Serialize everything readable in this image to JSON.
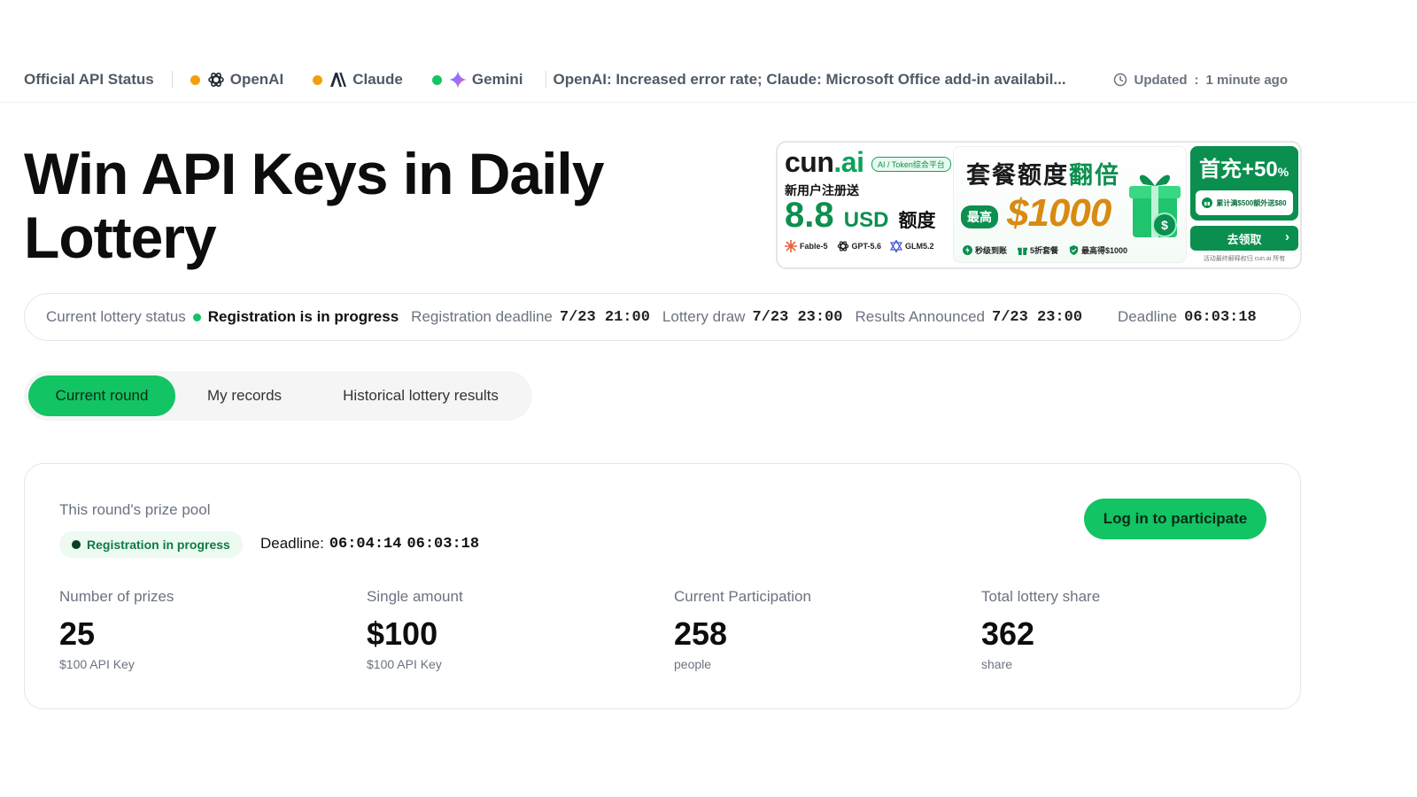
{
  "status_bar": {
    "title": "Official API Status",
    "providers": [
      {
        "name": "OpenAI",
        "status_color": "#f59e0b",
        "icon": "openai-icon"
      },
      {
        "name": "Claude",
        "status_color": "#f59e0b",
        "icon": "anthropic-icon"
      },
      {
        "name": "Gemini",
        "status_color": "#12c463",
        "icon": "gemini-icon"
      }
    ],
    "incident_text": "OpenAI: Increased error rate; Claude: Microsoft Office add-in availabil...",
    "updated_label": "Updated",
    "updated_sep": ":",
    "updated_value": "1 minute ago"
  },
  "hero": {
    "title": "Win API Keys in Daily Lottery"
  },
  "ad": {
    "brand_main": "cun",
    "brand_suffix": ".ai",
    "tag": "AI / Token综合平台",
    "register_text": "新用户注册送",
    "amount": "8.8",
    "amount_unit": "USD",
    "amount_cn": "额度",
    "models": [
      "Fable-5",
      "GPT-5.6",
      "GLM5.2"
    ],
    "headline_a": "套餐额度",
    "headline_b": "翻倍",
    "max_label": "最高",
    "max_amount": "$1000",
    "features": [
      "秒级到账",
      "5折套餐",
      "最高得$1000"
    ],
    "first_topup": "首充",
    "first_bonus": "+50",
    "first_pct": "%",
    "extra_text": "累计满$500额外送$80",
    "claim_label": "去领取",
    "footnote": "活动最终解释权归 cun.ai 所有"
  },
  "lottery_status": {
    "status_label": "Current lottery status",
    "status_value": "Registration is in progress",
    "reg_deadline_label": "Registration deadline",
    "reg_deadline_value": "7/23 21:00",
    "draw_label": "Lottery draw",
    "draw_value": "7/23 23:00",
    "results_label": "Results Announced",
    "results_value": "7/23 23:00",
    "deadline_label": "Deadline",
    "deadline_value": "06:03:18"
  },
  "tabs": [
    {
      "label": "Current round",
      "active": true
    },
    {
      "label": "My records",
      "active": false
    },
    {
      "label": "Historical lottery results",
      "active": false
    }
  ],
  "prize_pool": {
    "title": "This round's prize pool",
    "badge": "Registration in progress",
    "deadline_label": "Deadline:",
    "deadline_a": "06:04:14",
    "deadline_b": "06:03:18",
    "login_label": "Log in to participate",
    "stats": [
      {
        "label": "Number of prizes",
        "value": "25",
        "sub": "$100 API Key"
      },
      {
        "label": "Single amount",
        "value": "$100",
        "sub": "$100 API Key"
      },
      {
        "label": "Current Participation",
        "value": "258",
        "sub": "people"
      },
      {
        "label": "Total lottery share",
        "value": "362",
        "sub": "share"
      }
    ]
  },
  "colors": {
    "accent": "#12c463",
    "status_warning": "#f59e0b",
    "status_ok": "#12c463"
  }
}
